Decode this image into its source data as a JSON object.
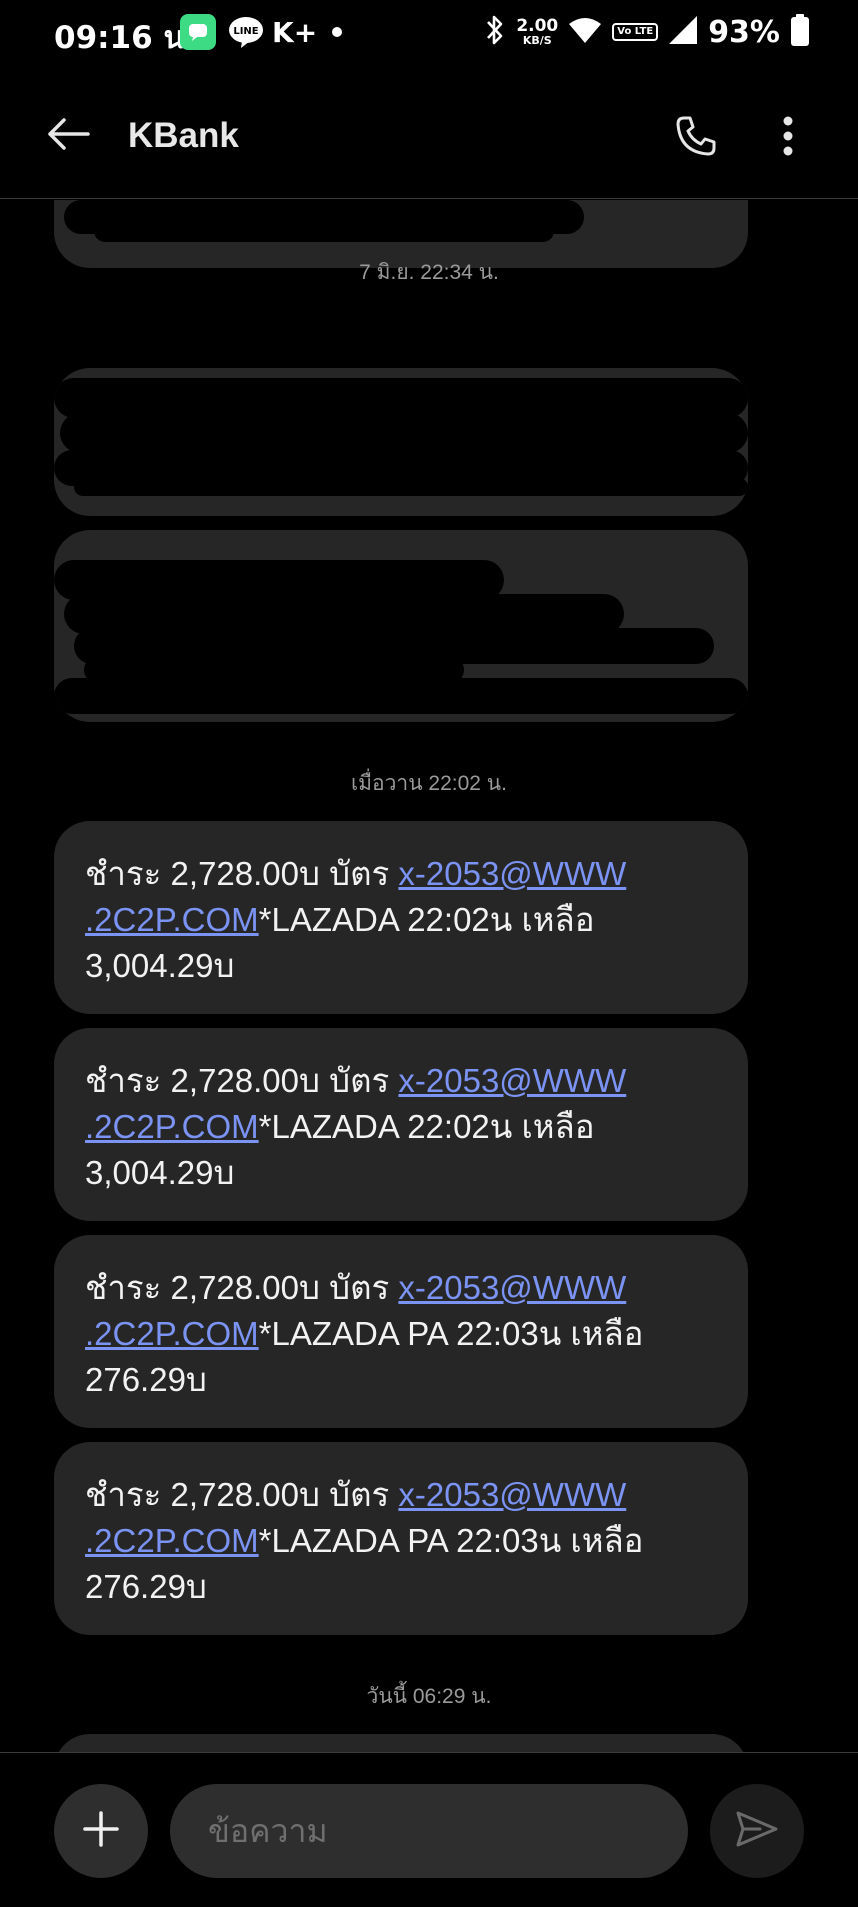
{
  "status_bar": {
    "time": "09:16 น.",
    "notification_icons": [
      "messages-icon",
      "line-icon",
      "k-plus-icon",
      "more-notifications-dot"
    ],
    "kplus_label": "K+",
    "line_label": "LINE",
    "network_speed_value": "2.00",
    "network_speed_unit": "KB/S",
    "volte_label": "Vo LTE",
    "battery_percent": "93%"
  },
  "app_bar": {
    "title": "KBank",
    "icons": [
      "back-arrow-icon",
      "phone-icon",
      "more-vertical-icon"
    ]
  },
  "conversation": {
    "timestamps": {
      "first": "7 มิ.ย. 22:34 น.",
      "second": "เมื่อวาน 22:02 น.",
      "third": "วันนี้ 06:29 น."
    },
    "messages": [
      {
        "text_before": "ชำระ 2,728.00บ บัตร ",
        "link_line1": "x-2053@WWW",
        "link_line2": ".2C2P.COM",
        "text_after": "*LAZADA  22:02น เหลือ",
        "text_last": "3,004.29บ"
      },
      {
        "text_before": "ชำระ 2,728.00บ บัตร ",
        "link_line1": "x-2053@WWW",
        "link_line2": ".2C2P.COM",
        "text_after": "*LAZADA  22:02น เหลือ",
        "text_last": "3,004.29บ"
      },
      {
        "text_before": "ชำระ 2,728.00บ บัตร ",
        "link_line1": "x-2053@WWW",
        "link_line2": ".2C2P.COM",
        "text_after": "*LAZADA PA 22:03น เหลือ",
        "text_last": "276.29บ"
      },
      {
        "text_before": "ชำระ 2,728.00บ บัตร ",
        "link_line1": "x-2053@WWW",
        "link_line2": ".2C2P.COM",
        "text_after": "*LAZADA PA 22:03น เหลือ",
        "text_last": "276.29บ"
      }
    ]
  },
  "composer": {
    "placeholder": "ข้อความ",
    "icons": [
      "plus-icon",
      "send-icon"
    ]
  },
  "colors": {
    "background": "#000000",
    "bubble": "#262626",
    "link": "#7b93f2",
    "timestamp": "#9a9a9a",
    "input_background": "#2e2e2e"
  }
}
